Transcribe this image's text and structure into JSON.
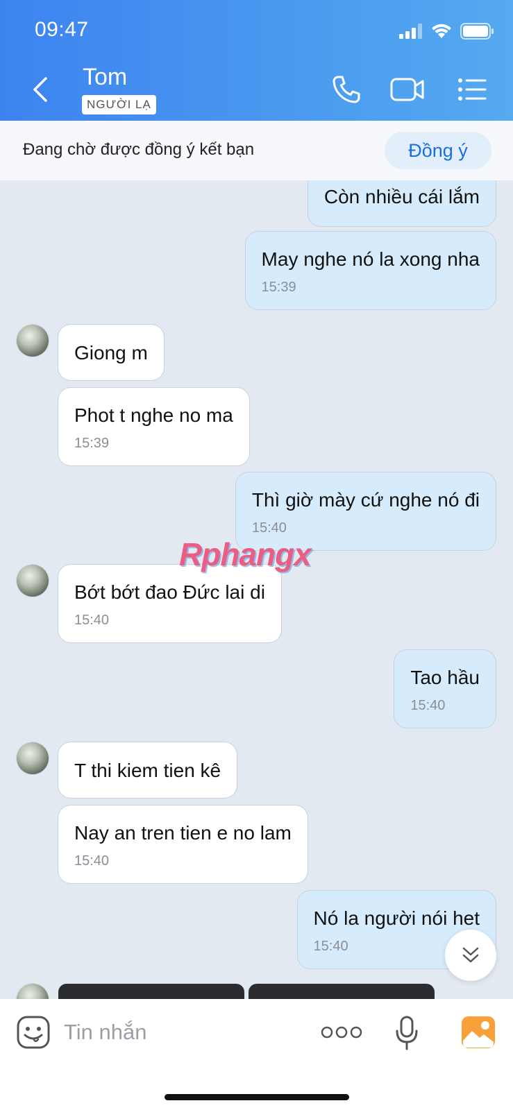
{
  "status_bar": {
    "time": "09:47"
  },
  "header": {
    "contact_name": "Tom",
    "badge": "NGƯỜI LẠ"
  },
  "friend_request": {
    "text": "Đang chờ được đồng ý kết bạn",
    "accept_label": "Đồng ý"
  },
  "messages": [
    {
      "from": "me",
      "text": "Còn nhiều cái lắm",
      "time": ""
    },
    {
      "from": "me",
      "text": "May nghe nó la xong nha",
      "time": "15:39"
    },
    {
      "from": "them",
      "text": "Giong m",
      "time": ""
    },
    {
      "from": "them",
      "text": "Phot t nghe no ma",
      "time": "15:39"
    },
    {
      "from": "me",
      "text": "Thì giờ mày cứ nghe nó đi",
      "time": "15:40"
    },
    {
      "from": "them",
      "text": "Bớt bớt đao Đức lai di",
      "time": "15:40"
    },
    {
      "from": "me",
      "text": "Tao hầu",
      "time": "15:40"
    },
    {
      "from": "them",
      "text": "T thi kiem tien kê",
      "time": ""
    },
    {
      "from": "them",
      "text": "Nay an tren tien e no lam",
      "time": "15:40"
    },
    {
      "from": "me",
      "text": "Nó la người nói het",
      "time": "15:40"
    }
  ],
  "watermark": "Rphangx",
  "input": {
    "placeholder": "Tin nhắn"
  },
  "colors": {
    "header_gradient_start": "#3d83f0",
    "header_gradient_end": "#55aaf0",
    "outgoing_bubble": "#d6ebfb",
    "incoming_bubble": "#ffffff",
    "chat_background": "#e2e9f1",
    "accent": "#1a6fe0"
  }
}
